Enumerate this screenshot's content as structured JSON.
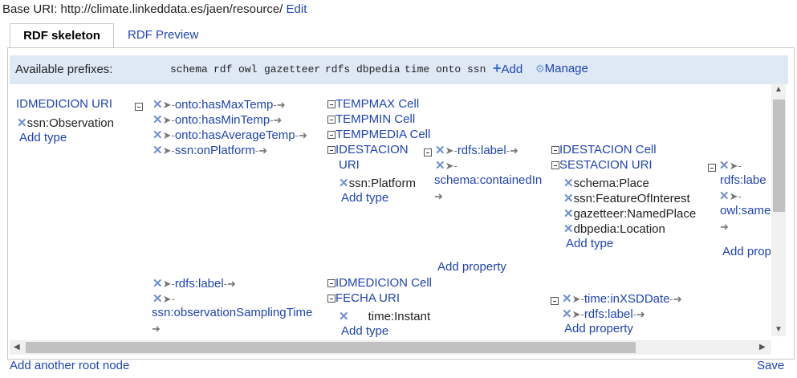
{
  "header": {
    "base_uri_label": "Base URI:",
    "base_uri": "http://climate.linkeddata.es/jaen/resource/",
    "edit": "Edit"
  },
  "tabs": {
    "skeleton": "RDF skeleton",
    "preview": "RDF Preview"
  },
  "prefixes": {
    "label": "Available prefixes:",
    "items": [
      "schema",
      "rdf",
      "owl",
      "gazetteer",
      "rdfs",
      "dbpedia",
      "time",
      "onto",
      "ssn"
    ],
    "add": "Add",
    "manage": "Manage"
  },
  "root": {
    "node": "IDMEDICION URI",
    "type": "ssn:Observation",
    "add_type": "Add type"
  },
  "props": {
    "p1": "onto:hasMaxTemp",
    "p2": "onto:hasMinTemp",
    "p3": "onto:hasAverageTemp",
    "p4": "ssn:onPlatform",
    "p5": "rdfs:label",
    "p6a": "ssn:",
    "p6b": "observationSamplingTime",
    "station_label": "rdfs:label",
    "station_contained": "schema:containedIn",
    "sest_label": "rdfs:labe",
    "sest_same": "owl:same",
    "fecha_date": "time:inXSDDate",
    "fecha_label": "rdfs:label"
  },
  "nodes": {
    "tempmax": "TEMPMAX Cell",
    "tempmin": "TEMPMIN Cell",
    "tempmedia": "TEMPMEDIA Cell",
    "idestacion_a": "IDESTACION",
    "idestacion_b": "URI",
    "station_type": "ssn:Platform",
    "add_type": "Add type",
    "idestacion_cell": "IDESTACION Cell",
    "sestacion": "SESTACION URI",
    "sest_types": [
      "schema:Place",
      "ssn:FeatureOfInterest",
      "gazetteer:NamedPlace",
      "dbpedia:Location"
    ],
    "idmedicion_cell": "IDMEDICION Cell",
    "fecha": "FECHA URI",
    "fecha_type": "time:Instant",
    "add_property": "Add property",
    "add_prop_cut": "Add prop"
  },
  "footer": {
    "add_root": "Add another root node",
    "save": "Save"
  }
}
